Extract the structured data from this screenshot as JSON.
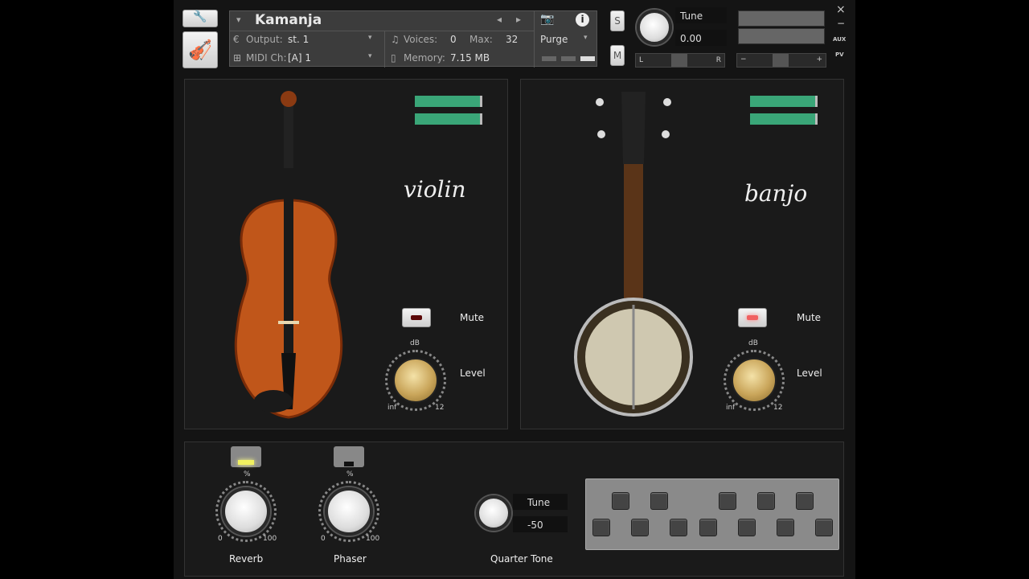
{
  "header": {
    "instrument_name": "Kamanja",
    "output_label": "Output:",
    "output_value": "st. 1",
    "voices_label": "Voices:",
    "voices_value": "0",
    "max_label": "Max:",
    "max_value": "32",
    "midi_label": "MIDI Ch:",
    "midi_value": "[A] 1",
    "memory_label": "Memory:",
    "memory_value": "7.15 MB",
    "purge_label": "Purge",
    "solo_label": "S",
    "mute_label": "M",
    "tune_label": "Tune",
    "tune_value": "0.00",
    "pan_left": "L",
    "pan_right": "R",
    "vol_minus": "−",
    "vol_plus": "+",
    "close": "×",
    "minimize": "−",
    "aux": "AUX",
    "pv": "PV"
  },
  "violin": {
    "name": "violin",
    "mute_label": "Mute",
    "level_label": "Level",
    "db_label": "dB",
    "min_label": "inf",
    "max_label": "12",
    "muted": true
  },
  "banjo": {
    "name": "banjo",
    "mute_label": "Mute",
    "level_label": "Level",
    "db_label": "dB",
    "min_label": "inf",
    "max_label": "12",
    "muted": true
  },
  "effects": {
    "reverb": {
      "label": "Reverb",
      "unit": "%",
      "min": "0",
      "max": "100",
      "enabled": true
    },
    "phaser": {
      "label": "Phaser",
      "unit": "%",
      "min": "0",
      "max": "100",
      "enabled": false
    }
  },
  "quarter_tone": {
    "label": "Quarter Tone",
    "tune_label": "Tune",
    "tune_value": "-50"
  },
  "colors": {
    "meter": "#3aa678",
    "led_on": "#f0f060",
    "bg": "#141414"
  }
}
